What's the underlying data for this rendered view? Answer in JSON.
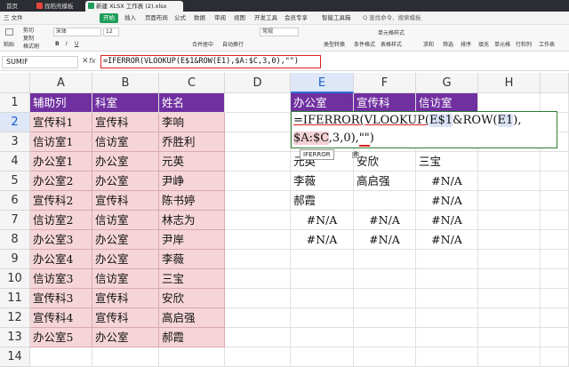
{
  "titlebar": {
    "tabs": [
      {
        "label": "首页",
        "active": false
      },
      {
        "label": "找稻壳模板",
        "active": false
      },
      {
        "label": "新建 XLSX 工作表 (2).xlsx",
        "active": true
      }
    ]
  },
  "menubar": {
    "file": "三 文件",
    "items": [
      "开始",
      "插入",
      "页面布局",
      "公式",
      "数据",
      "审阅",
      "视图",
      "开发工具",
      "会员专享",
      "智能工具箱"
    ],
    "search": "Q 查找命令、搜索模板"
  },
  "toolbar": {
    "paste": "粘贴",
    "cut": "剪切",
    "copy": "复制",
    "format_painter": "格式刷",
    "font_name": "宋体",
    "font_size": "12",
    "merge": "合并居中",
    "wrap": "自动换行",
    "number_format": "常规",
    "type_convert": "类型转换",
    "cond_format": "条件格式",
    "table_style": "表格样式",
    "cell_style": "单元格样式",
    "sum": "求和",
    "filter": "筛选",
    "sort": "排序",
    "fill": "填充",
    "cell": "单元格",
    "row_col": "行和列",
    "worksheet": "工作表"
  },
  "formula_bar": {
    "name_box": "SUMIF",
    "fx": "fx",
    "formula": "=IFERROR(VLOOKUP(E$1&ROW(E1),$A:$C,3,0),\"\")"
  },
  "columns": [
    "A",
    "B",
    "C",
    "D",
    "E",
    "F",
    "G",
    "H"
  ],
  "rows": [
    "1",
    "2",
    "3",
    "4",
    "5",
    "6",
    "7",
    "8",
    "9",
    "10",
    "11",
    "12",
    "13",
    "14"
  ],
  "sheet": {
    "A": [
      "辅助列",
      "宣传科1",
      "信访室1",
      "办公室1",
      "办公室2",
      "宣传科2",
      "信访室2",
      "办公室3",
      "办公室4",
      "信访室3",
      "宣传科3",
      "宣传科4",
      "办公室5",
      ""
    ],
    "B": [
      "科室",
      "宣传科",
      "信访室",
      "办公室",
      "办公室",
      "宣传科",
      "信访室",
      "办公室",
      "办公室",
      "信访室",
      "宣传科",
      "宣传科",
      "办公室",
      ""
    ],
    "C": [
      "姓名",
      "李响",
      "乔胜利",
      "元英",
      "尹峥",
      "陈书婷",
      "林志为",
      "尹岸",
      "李薇",
      "三宝",
      "安欣",
      "高启强",
      "郝霞",
      ""
    ],
    "E1": "办公室",
    "F1": "宣传科",
    "G1": "信访室",
    "E4": "元英",
    "F4": "安欣",
    "G4": "三宝",
    "E5": "李薇",
    "F5": "高启强",
    "G5": "#N/A",
    "E6": "郝霞",
    "G6": "#N/A",
    "E7": "#N/A",
    "F7": "#N/A",
    "G7": "#N/A",
    "E8": "#N/A",
    "F8": "#N/A",
    "G8": "#N/A"
  },
  "editor": {
    "p1": "=IFERROR(VLOOKUP(",
    "p2": "E$1",
    "p3": "&ROW(",
    "p4": "E1",
    "p5": "), ",
    "p6": "$A:$C",
    "p7": ",3,0),",
    "p8": "\"\"",
    "p9": ")",
    "tooltip": "IFERROR",
    "tooltip_icon": "函"
  },
  "colors": {
    "header_purple": "#7030a0",
    "pink_fill": "#f6d5d8",
    "accent_green": "#1e9e5a",
    "formula_border": "#e02020"
  }
}
